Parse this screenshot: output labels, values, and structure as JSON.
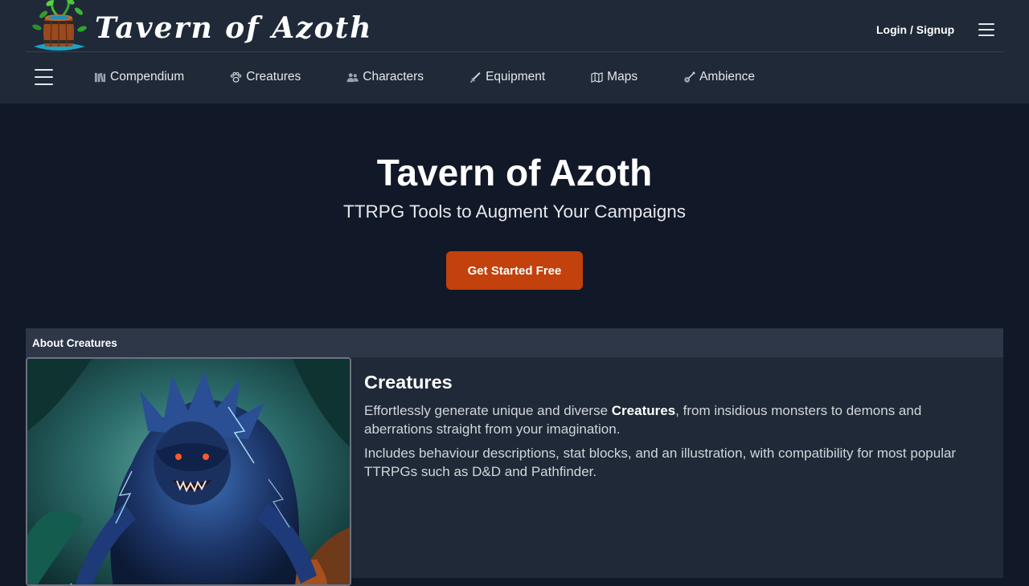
{
  "brand": {
    "title": "Tavern of Azoth",
    "logo_icon": "tavern-barrel-logo-icon"
  },
  "header": {
    "login_label": "Login / Signup",
    "menu_icon": "hamburger-menu-icon"
  },
  "nav": {
    "menu_icon": "hamburger-menu-icon",
    "items": [
      {
        "label": "Compendium",
        "icon": "books-icon"
      },
      {
        "label": "Creatures",
        "icon": "paw-icon"
      },
      {
        "label": "Characters",
        "icon": "users-icon"
      },
      {
        "label": "Equipment",
        "icon": "sword-icon"
      },
      {
        "label": "Maps",
        "icon": "map-icon"
      },
      {
        "label": "Ambience",
        "icon": "guitar-icon"
      }
    ]
  },
  "hero": {
    "title": "Tavern of Azoth",
    "subtitle": "TTRPG Tools to Augment Your Campaigns",
    "cta_label": "Get Started Free"
  },
  "about": {
    "header": "About Creatures",
    "title": "Creatures",
    "image_alt": "creature-illustration",
    "para1_before": "Effortlessly generate unique and diverse ",
    "para1_strong": "Creatures",
    "para1_after": ", from insidious monsters to demons and aberrations straight from your imagination.",
    "para2": "Includes behaviour descriptions, stat blocks, and an illustration, with compatibility for most popular TTRPGs such as D&D and Pathfinder."
  },
  "colors": {
    "page_bg": "#111827",
    "header_bg": "#1f2937",
    "accent": "#c2410c",
    "panel_header_bg": "#2d3748"
  }
}
